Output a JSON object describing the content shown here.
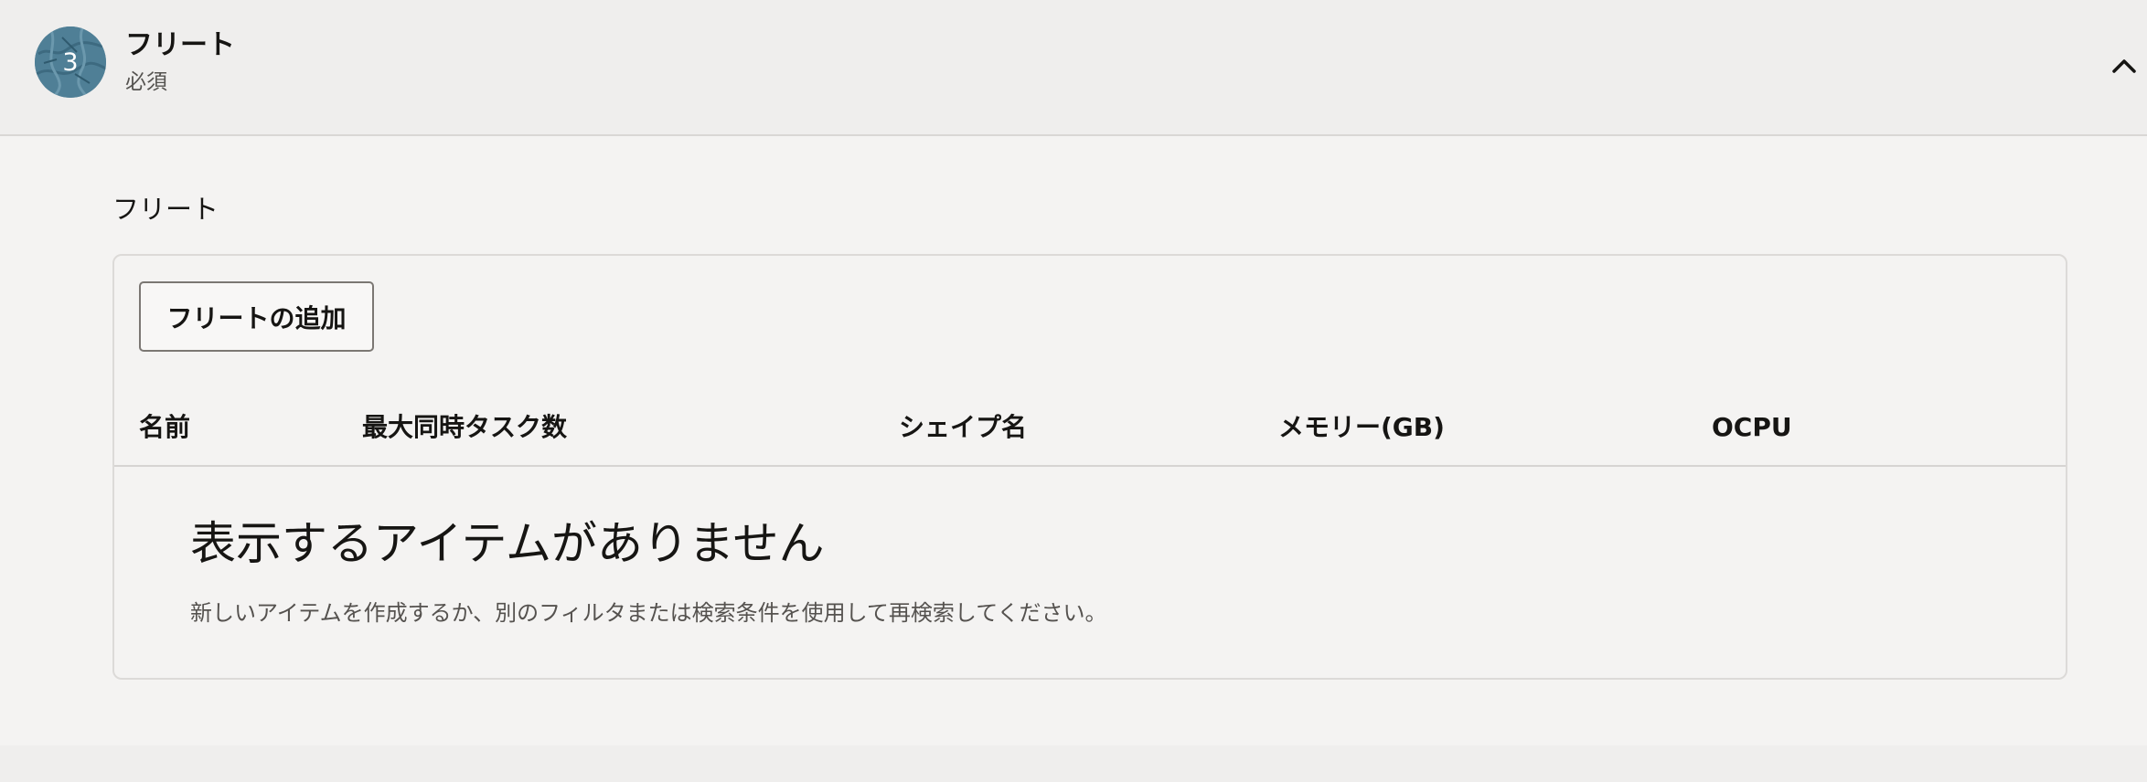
{
  "step": {
    "number": "3",
    "title": "フリート",
    "subtitle": "必須",
    "toggle_icon": "chevron-up-icon"
  },
  "section": {
    "label": "フリート",
    "add_button_label": "フリートの追加"
  },
  "table": {
    "columns": [
      "名前",
      "最大同時タスク数",
      "シェイプ名",
      "メモリー(GB)",
      "OCPU"
    ],
    "rows": []
  },
  "empty_state": {
    "title": "表示するアイテムがありません",
    "description": "新しいアイテムを作成するか、別のフィルタまたは検索条件を使用して再検索してください。"
  },
  "colors": {
    "badge": "#4d7c93",
    "background": "#f3f2f1",
    "header_background": "#efeeed"
  }
}
